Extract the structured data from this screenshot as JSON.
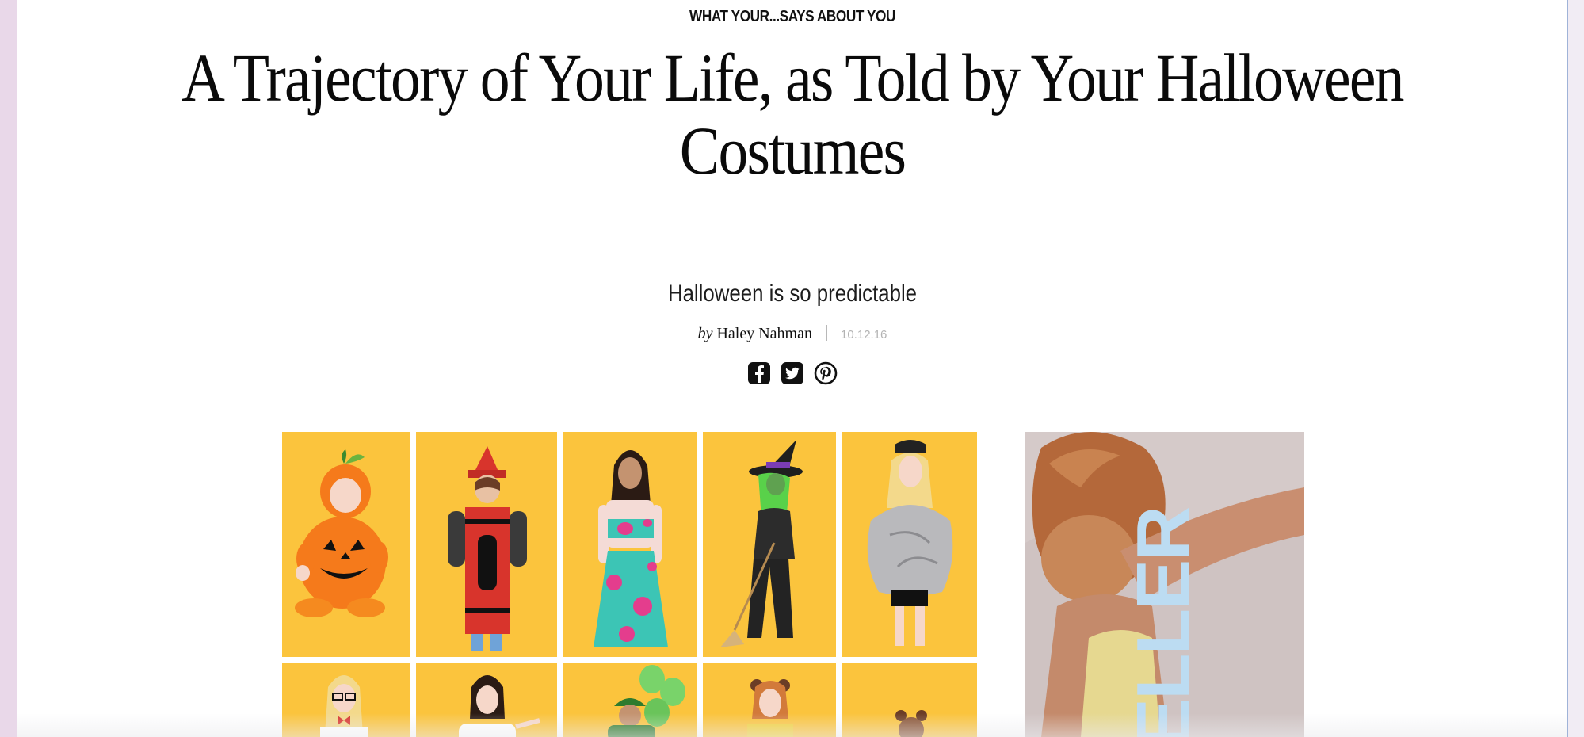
{
  "article": {
    "kicker": "WHAT YOUR...SAYS ABOUT YOU",
    "headline": "A Trajectory of Your Life, as Told by Your Halloween Costumes",
    "dek": "Halloween is so predictable",
    "byline": {
      "by": "by",
      "author": "Haley Nahman",
      "date": "10.12.16"
    }
  },
  "share": [
    {
      "name": "facebook-share-icon",
      "icon": "facebook"
    },
    {
      "name": "twitter-share-icon",
      "icon": "twitter"
    },
    {
      "name": "pinterest-share-icon",
      "icon": "pinterest"
    }
  ],
  "illustration": {
    "tile_color": "#fbc43d",
    "costumes": [
      "pumpkin",
      "crayon",
      "hippie",
      "witch",
      "rock",
      "nerd",
      "waitress",
      "green-balloon",
      "bear-ears",
      "bear"
    ]
  },
  "ad": {
    "word": "ELLER",
    "word_color": "#bcdcf2"
  },
  "colors": {
    "frame": "#e9d8e9",
    "text": "#0a0a0a",
    "muted": "#b3b3b3"
  }
}
